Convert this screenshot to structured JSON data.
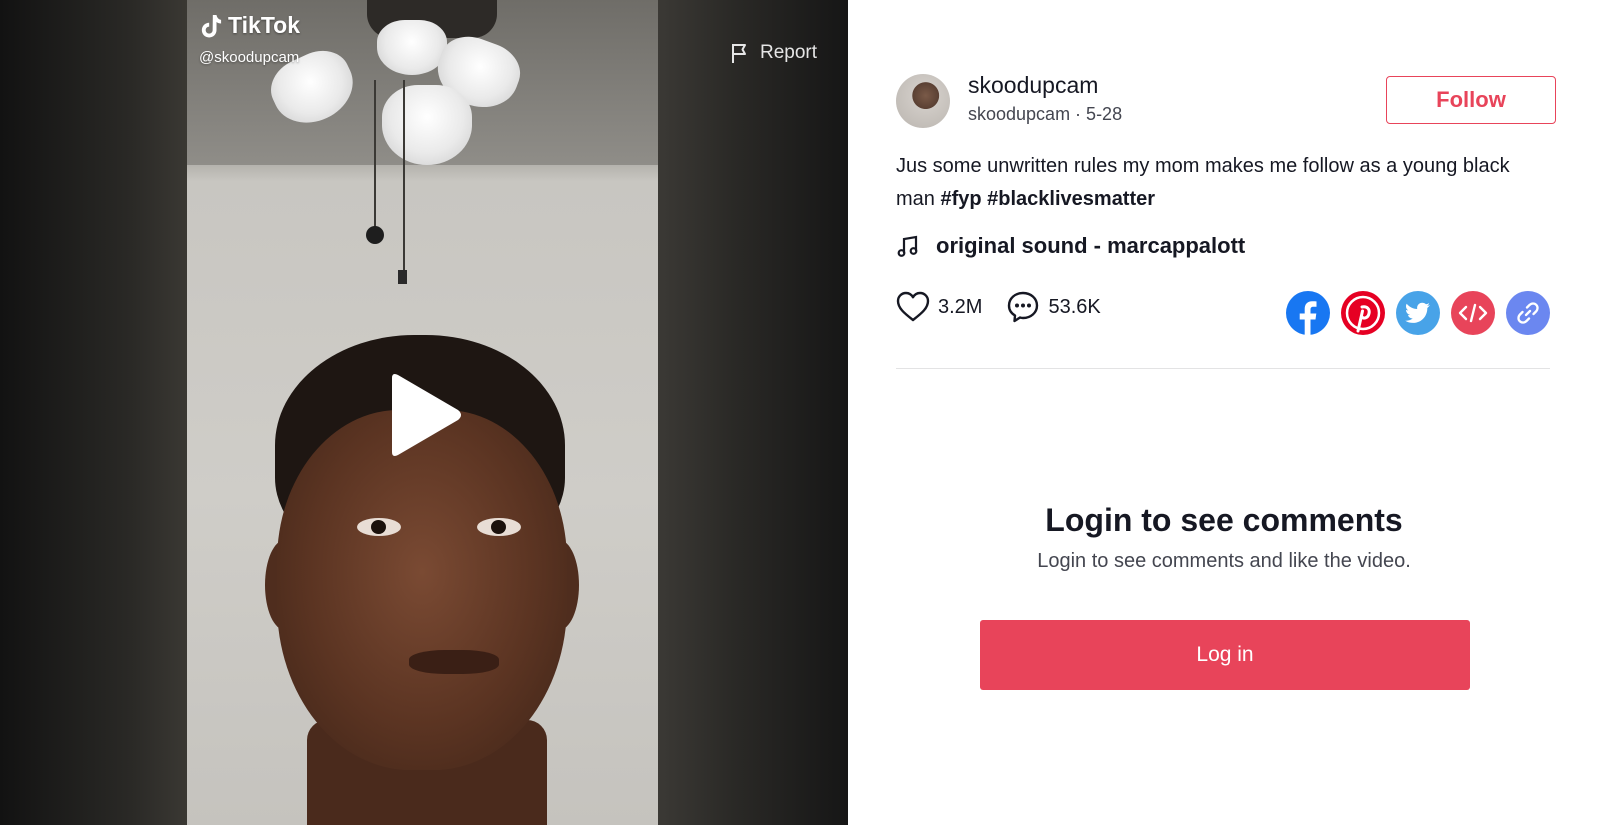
{
  "video": {
    "brand_name": "TikTok",
    "handle": "@skoodupcam",
    "report_label": "Report"
  },
  "author": {
    "username": "skoodupcam",
    "meta": "skoodupcam · 5-28",
    "follow_label": "Follow"
  },
  "caption": {
    "text": "Jus some unwritten rules my mom makes me follow as a young black man",
    "hashtags": [
      "#fyp",
      "#blacklivesmatter"
    ]
  },
  "music": {
    "title": "original sound - marcappalott"
  },
  "stats": {
    "likes": "3.2M",
    "comments": "53.6K"
  },
  "share": {
    "icons": [
      "facebook-icon",
      "pinterest-icon",
      "twitter-icon",
      "embed-icon",
      "link-icon"
    ],
    "colors": {
      "facebook": "#1877f2",
      "pinterest": "#e60023",
      "twitter": "#48a3e8",
      "embed": "#e8445a",
      "link": "#6b87f0"
    }
  },
  "login": {
    "title": "Login to see comments",
    "subtitle": "Login to see comments and like the video.",
    "button_label": "Log in"
  },
  "colors": {
    "accent": "#e8445a",
    "text_primary": "#161823",
    "text_secondary": "#444650"
  }
}
